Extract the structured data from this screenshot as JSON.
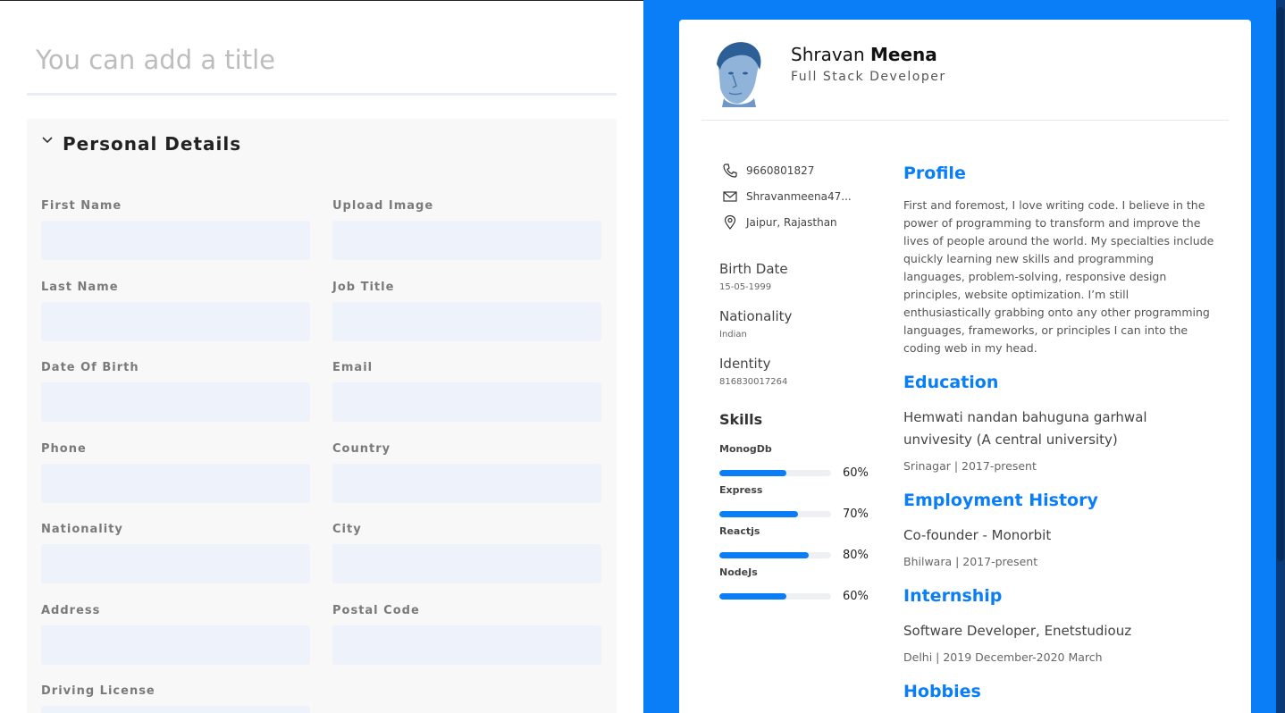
{
  "editor": {
    "title_placeholder": "You can add a title",
    "section_title": "Personal Details",
    "fields": {
      "first_name": "First Name",
      "upload_image": "Upload Image",
      "last_name": "Last Name",
      "job_title": "Job Title",
      "dob": "Date Of Birth",
      "email": "Email",
      "phone": "Phone",
      "country": "Country",
      "nationality": "Nationality",
      "city": "City",
      "address": "Address",
      "postal_code": "Postal Code",
      "driving_license": "Driving License"
    }
  },
  "resume": {
    "first_name": "Shravan",
    "last_name": "Meena",
    "job_title": "Full Stack Developer",
    "phone": "9660801827",
    "email": "Shravanmeena47...",
    "location": "Jaipur, Rajasthan",
    "birth_date_label": "Birth Date",
    "birth_date": "15-05-1999",
    "nationality_label": "Nationality",
    "nationality": "Indian",
    "identity_label": "Identity",
    "identity": "816830017264",
    "skills_title": "Skills",
    "skills": [
      {
        "name": "MonogDb",
        "level": 60,
        "pct": "60%"
      },
      {
        "name": "Express",
        "level": 70,
        "pct": "70%"
      },
      {
        "name": "Reactjs",
        "level": 80,
        "pct": "80%"
      },
      {
        "name": "NodeJs",
        "level": 60,
        "pct": "60%"
      }
    ],
    "profile_title": "Profile",
    "profile_text": "First and foremost, I love writing code. I believe in the power of programming to transform and improve the lives of people around the world. My specialties include quickly learning new skills and programming languages, problem-solving, responsive design principles, website optimization. I’m still enthusiastically grabbing onto any other programming languages, frameworks, or principles I can into the coding web in my head.",
    "education_title": "Education",
    "education_item": "Hemwati nandan bahuguna garhwal unvivesity (A central university)",
    "education_sub": "Srinagar | 2017-present",
    "employment_title": "Employment History",
    "employment_item": "Co-founder - Monorbit",
    "employment_sub": "Bhilwara | 2017-present",
    "internship_title": "Internship",
    "internship_item": "Software Developer, Enetstudiouz",
    "internship_sub": "Delhi | 2019 December-2020 March",
    "hobbies_title": "Hobbies"
  },
  "colors": {
    "accent": "#0a7ef6",
    "field_bg": "#eef2fb",
    "section_bg": "#f8f8f8"
  }
}
